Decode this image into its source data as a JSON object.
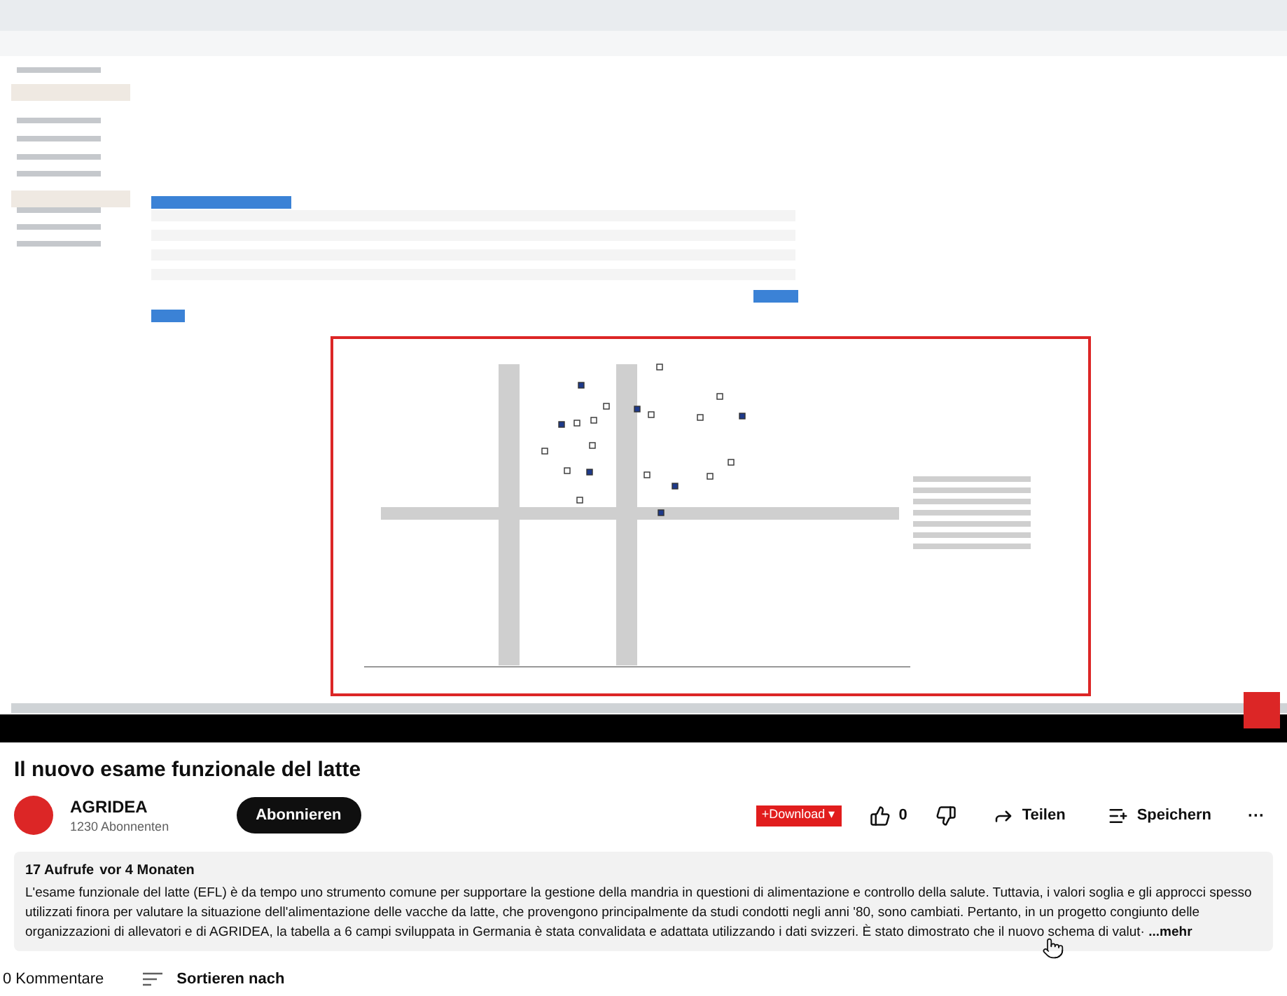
{
  "video": {
    "kind": "screen-recording"
  },
  "title": "Il nuovo esame funzionale del latte",
  "channel": {
    "name": "AGRIDEA",
    "subscribers": "1230 Abonnenten",
    "subscribe_label": "Abonnieren"
  },
  "actions": {
    "download": "+Download ▾",
    "likes": "0",
    "share": "Teilen",
    "save": "Speichern",
    "more": "···"
  },
  "description": {
    "views": "17 Aufrufe",
    "age": "vor 4 Monaten",
    "text": "L'esame funzionale del latte (EFL) è da tempo uno strumento comune per supportare la gestione della mandria in questioni di alimentazione e controllo della salute. Tuttavia, i valori soglia e gli approcci spesso utilizzati finora per valutare la situazione dell'alimentazione delle vacche da latte, che provengono principalmente da studi condotti negli anni '80, sono cambiati. Pertanto, in un progetto congiunto delle organizzazioni di allevatori e di AGRIDEA, la tabella a 6 campi sviluppata in Germania è stata convalidata e adattata utilizzando i dati svizzeri. È stato dimostrato che il nuovo schema di valut·",
    "more": "...mehr"
  },
  "comments": {
    "count": "0 Kommentare",
    "sort_label": "Sortieren nach"
  }
}
